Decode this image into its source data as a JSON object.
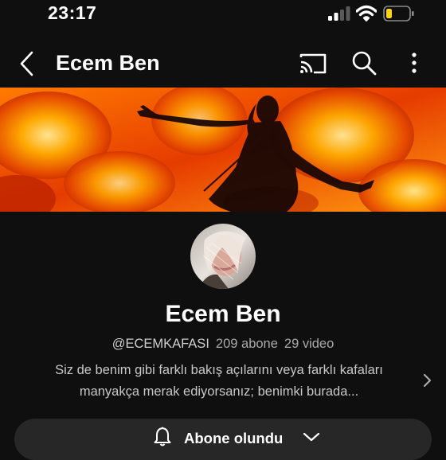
{
  "status_bar": {
    "time": "23:17",
    "signal_icon": "cellular-signal-icon",
    "wifi_icon": "wifi-icon",
    "battery_icon": "battery-low-icon",
    "battery_color": "#ffd60a"
  },
  "app_bar": {
    "title": "Ecem Ben",
    "back_icon": "chevron-left-icon",
    "cast_icon": "cast-icon",
    "search_icon": "search-icon",
    "more_icon": "more-vertical-icon"
  },
  "channel": {
    "name": "Ecem Ben",
    "handle": "@ECEMKAFASI",
    "subscribers": "209 abone",
    "videos": "29 video",
    "description": "Siz de benim gibi farklı bakış açılarını veya farklı kafaları manyakça merak ediyorsanız; benimki burada..."
  },
  "subscribe_button": {
    "label": "Abone olundu",
    "bell_icon": "bell-icon",
    "dropdown_icon": "chevron-down-icon"
  },
  "colors": {
    "background": "#0f0f0f",
    "button_bg": "#272727",
    "secondary_text": "#aaaaaa"
  }
}
